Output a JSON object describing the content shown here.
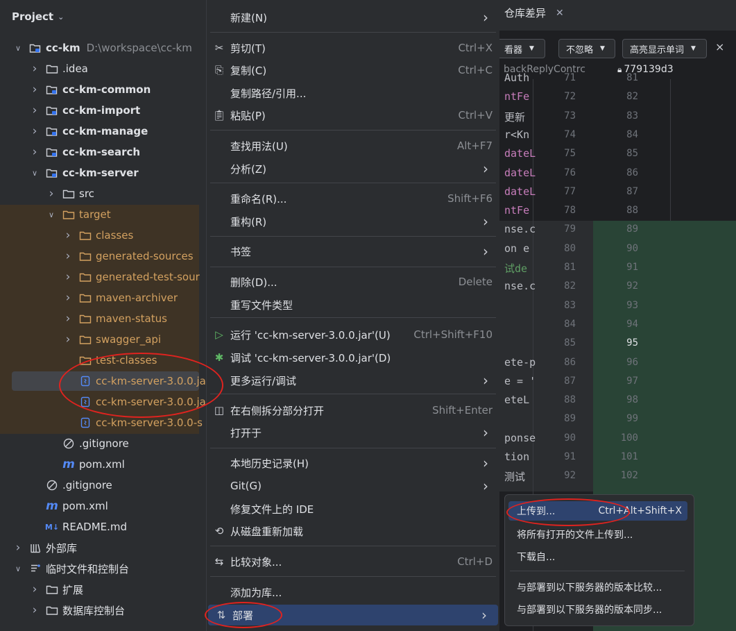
{
  "project": {
    "title": "Project",
    "tree": [
      {
        "label": "cc-km",
        "path": "D:\\workspace\\cc-km",
        "icon": "module-folder-icon",
        "expanded": true
      },
      {
        "label": ".idea",
        "icon": "folder-icon",
        "expanded": false
      },
      {
        "label": "cc-km-common",
        "icon": "module-folder-icon",
        "expanded": false
      },
      {
        "label": "cc-km-import",
        "icon": "module-folder-icon",
        "expanded": false
      },
      {
        "label": "cc-km-manage",
        "icon": "module-folder-icon",
        "expanded": false
      },
      {
        "label": "cc-km-search",
        "icon": "module-folder-icon",
        "expanded": false
      },
      {
        "label": "cc-km-server",
        "icon": "module-folder-icon",
        "expanded": true
      },
      {
        "label": "src",
        "icon": "folder-icon",
        "expanded": false
      },
      {
        "label": "target",
        "icon": "excluded-folder-icon",
        "expanded": true
      },
      {
        "label": "classes",
        "icon": "excluded-folder-icon",
        "expanded": false
      },
      {
        "label": "generated-sources",
        "icon": "excluded-folder-icon",
        "expanded": false
      },
      {
        "label": "generated-test-sour",
        "icon": "excluded-folder-icon",
        "expanded": false
      },
      {
        "label": "maven-archiver",
        "icon": "excluded-folder-icon",
        "expanded": false
      },
      {
        "label": "maven-status",
        "icon": "excluded-folder-icon",
        "expanded": false
      },
      {
        "label": "swagger_api",
        "icon": "excluded-folder-icon",
        "expanded": false
      },
      {
        "label": "test-classes",
        "icon": "excluded-folder-icon"
      },
      {
        "label": "cc-km-server-3.0.0.ja",
        "icon": "jar-icon"
      },
      {
        "label": "cc-km-server-3.0.0.ja",
        "icon": "jar-icon"
      },
      {
        "label": "cc-km-server-3.0.0-s",
        "icon": "jar-icon"
      },
      {
        "label": ".gitignore",
        "icon": "gitignore-icon"
      },
      {
        "label": "pom.xml",
        "icon": "maven-icon"
      },
      {
        "label": ".gitignore",
        "icon": "gitignore-icon"
      },
      {
        "label": "pom.xml",
        "icon": "maven-icon"
      },
      {
        "label": "README.md",
        "icon": "markdown-icon"
      },
      {
        "label": "外部库",
        "icon": "library-icon",
        "expanded": false
      },
      {
        "label": "临时文件和控制台",
        "icon": "scratches-icon",
        "expanded": true
      },
      {
        "label": "扩展",
        "icon": "folder-icon",
        "expanded": false
      },
      {
        "label": "数据库控制台",
        "icon": "folder-icon",
        "expanded": false
      }
    ]
  },
  "editor": {
    "tab_label": "仓库差异",
    "toolbar": {
      "viewer": "看器",
      "ignore": "不忽略",
      "highlight": "高亮显示单词"
    },
    "file_fragment": "backReplyContrc",
    "revision": "779139d3",
    "left_lines": [
      "71",
      "72",
      "73",
      "74",
      "75",
      "76",
      "77",
      "78",
      "79",
      "80",
      "81",
      "82",
      "83",
      "84",
      "85",
      "86",
      "87",
      "88",
      "89",
      "90",
      "91",
      "92"
    ],
    "right_lines": [
      "81",
      "82",
      "83",
      "84",
      "85",
      "86",
      "87",
      "88",
      "89",
      "90",
      "91",
      "92",
      "93",
      "94",
      "95",
      "96",
      "97",
      "98",
      "99",
      "100",
      "101",
      "102"
    ],
    "code": [
      "Auth",
      "ntFe",
      "更新",
      "r<Kn",
      "dateL",
      "dateL",
      "dateL",
      "ntFe",
      "nse.c",
      "on e",
      "试de",
      "nse.c",
      "",
      "",
      "",
      "ete-p",
      "e = '",
      "eteL",
      "",
      "ponse",
      "tion",
      "测试"
    ]
  },
  "context_menu": {
    "items": [
      {
        "label": "新建(N)",
        "submenu": true
      },
      {
        "label": "剪切(T)",
        "shortcut": "Ctrl+X",
        "icon": "scissors-icon"
      },
      {
        "label": "复制(C)",
        "shortcut": "Ctrl+C",
        "icon": "copy-icon"
      },
      {
        "label": "复制路径/引用..."
      },
      {
        "label": "粘贴(P)",
        "shortcut": "Ctrl+V",
        "icon": "paste-icon"
      },
      {
        "label": "查找用法(U)",
        "shortcut": "Alt+F7"
      },
      {
        "label": "分析(Z)",
        "submenu": true
      },
      {
        "label": "重命名(R)...",
        "shortcut": "Shift+F6"
      },
      {
        "label": "重构(R)",
        "submenu": true
      },
      {
        "label": "书签",
        "submenu": true
      },
      {
        "label": "删除(D)...",
        "shortcut": "Delete"
      },
      {
        "label": "重写文件类型"
      },
      {
        "label": "运行 'cc-km-server-3.0.0.jar'(U)",
        "shortcut": "Ctrl+Shift+F10",
        "icon": "run-icon"
      },
      {
        "label": "调试 'cc-km-server-3.0.0.jar'(D)",
        "icon": "debug-icon"
      },
      {
        "label": "更多运行/调试",
        "submenu": true
      },
      {
        "label": "在右侧拆分部分打开",
        "shortcut": "Shift+Enter",
        "icon": "split-icon"
      },
      {
        "label": "打开于",
        "submenu": true
      },
      {
        "label": "本地历史记录(H)",
        "submenu": true
      },
      {
        "label": "Git(G)",
        "submenu": true
      },
      {
        "label": "修复文件上的 IDE"
      },
      {
        "label": "从磁盘重新加载",
        "icon": "reload-icon"
      },
      {
        "label": "比较对象...",
        "shortcut": "Ctrl+D",
        "icon": "compare-icon"
      },
      {
        "label": "添加为库..."
      },
      {
        "label": "部署",
        "submenu": true,
        "icon": "deploy-icon",
        "active": true
      }
    ]
  },
  "deploy_submenu": {
    "items": [
      {
        "label": "上传到...",
        "shortcut": "Ctrl+Alt+Shift+X",
        "active": true
      },
      {
        "label": "将所有打开的文件上传到..."
      },
      {
        "label": "下载自..."
      },
      {
        "label": "与部署到以下服务器的版本比较..."
      },
      {
        "label": "与部署到以下服务器的版本同步..."
      }
    ]
  },
  "colors": {
    "panel_bg": "#2b2d30",
    "editor_bg": "#1e1f22",
    "selection": "#2e436e",
    "excluded_folder": "#d3a160",
    "diff_added": "#294436",
    "annotation": "#e0231f"
  }
}
